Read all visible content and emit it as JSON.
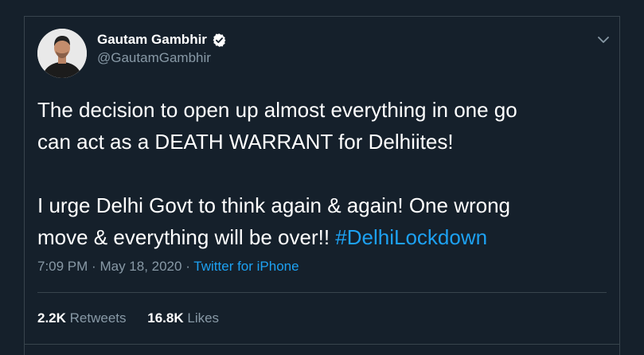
{
  "author": {
    "display_name": "Gautam Gambhir",
    "handle": "@GautamGambhir",
    "verified": true
  },
  "tweet": {
    "line1": "The decision to open up almost everything in one go",
    "line2": "can act as a DEATH WARRANT for Delhiites!",
    "line3": "I urge Delhi Govt to think again & again! One wrong",
    "line4": "move & everything will be over!!",
    "hashtag": "#DelhiLockdown"
  },
  "meta": {
    "time": "7:09 PM",
    "separator1": "·",
    "date": "May 18, 2020",
    "separator2": "·",
    "source": "Twitter for iPhone"
  },
  "stats": {
    "retweets_count": "2.2K",
    "retweets_label": "Retweets",
    "likes_count": "16.8K",
    "likes_label": "Likes"
  },
  "colors": {
    "background": "#15202b",
    "accent": "#1da1f2",
    "secondary_text": "#8899a6",
    "divider": "#38444d"
  },
  "icons": {
    "verified": "verified-badge-icon",
    "more": "chevron-down-icon"
  }
}
